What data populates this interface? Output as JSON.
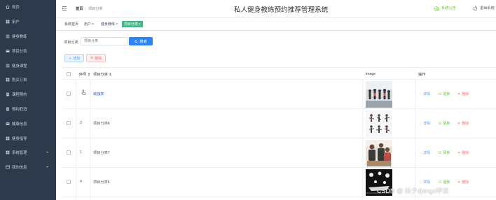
{
  "sidebar": {
    "items": [
      {
        "label": "首页",
        "icon": "home-icon"
      },
      {
        "label": "用户",
        "icon": "grid-icon"
      },
      {
        "label": "健身教练",
        "icon": "list-icon"
      },
      {
        "label": "项目分类",
        "icon": "card-icon"
      },
      {
        "label": "健身课程",
        "icon": "list-icon"
      },
      {
        "label": "购买订单",
        "icon": "grid-icon"
      },
      {
        "label": "课程预约",
        "icon": "doc-icon"
      },
      {
        "label": "预约取消",
        "icon": "doc-icon"
      },
      {
        "label": "健康信息",
        "icon": "card-icon"
      },
      {
        "label": "健身指导",
        "icon": "grid-icon"
      },
      {
        "label": "系统管理",
        "icon": "grid-icon",
        "expandable": true
      },
      {
        "label": "我的信息",
        "icon": "window-icon",
        "expandable": true
      }
    ]
  },
  "header": {
    "breadcrumb_home": "首页",
    "breadcrumb_separator": "/",
    "breadcrumb_current": "项目分类",
    "title": "私人健身教练预约推荐管理系统",
    "notice_label": "系统公告",
    "logout_label": "退出系统"
  },
  "tags": [
    {
      "label": "系统首页",
      "closable": false,
      "active": false
    },
    {
      "label": "用户",
      "closable": true,
      "active": false
    },
    {
      "label": "健身教练",
      "closable": true,
      "active": false
    },
    {
      "label": "项目分类",
      "closable": true,
      "active": true
    }
  ],
  "search": {
    "label": "项目分类",
    "placeholder": "项目分类",
    "button_label": "搜索"
  },
  "actions": {
    "add_label": "增加",
    "delete_label": "删除"
  },
  "table": {
    "columns": {
      "index": "序号",
      "category": "项目分类",
      "image": "image",
      "operations": "操作"
    },
    "rows": [
      {
        "index": "",
        "category": "瑜伽类",
        "image": "yoga-group-photo"
      },
      {
        "index": "2",
        "category": "项目分类8",
        "image": "people-poses-photo"
      },
      {
        "index": "1",
        "category": "项目分类7",
        "image": "group-chat-photo"
      },
      {
        "index": "4",
        "category": "项目分类6",
        "image": "dark-lights-photo"
      }
    ],
    "op_detail": "详情",
    "op_update": "更新",
    "op_delete": "删除"
  },
  "watermark": "CSDN @ 林夕django毕设",
  "colors": {
    "sidebar_bg": "#2d3a4b",
    "primary": "#2a84f6",
    "tag_active": "#42b983",
    "success": "#67c23a",
    "danger": "#f56c6c"
  }
}
